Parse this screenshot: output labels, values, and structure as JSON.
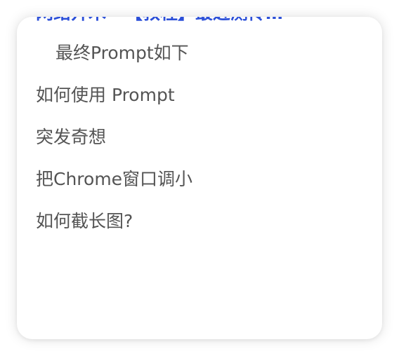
{
  "toc": {
    "items": [
      {
        "label": "网络开木 · 【教程】最近测传…",
        "active": true
      },
      {
        "label": "最终Prompt如下",
        "active": false
      },
      {
        "label": "如何使用 Prompt",
        "active": false
      },
      {
        "label": "突发奇想",
        "active": false
      },
      {
        "label": "把Chrome窗口调小",
        "active": false
      },
      {
        "label": "如何截长图?",
        "active": false
      }
    ]
  },
  "colors": {
    "active_link": "#2b4fd8",
    "text": "#545454",
    "card_background": "#ffffff"
  }
}
